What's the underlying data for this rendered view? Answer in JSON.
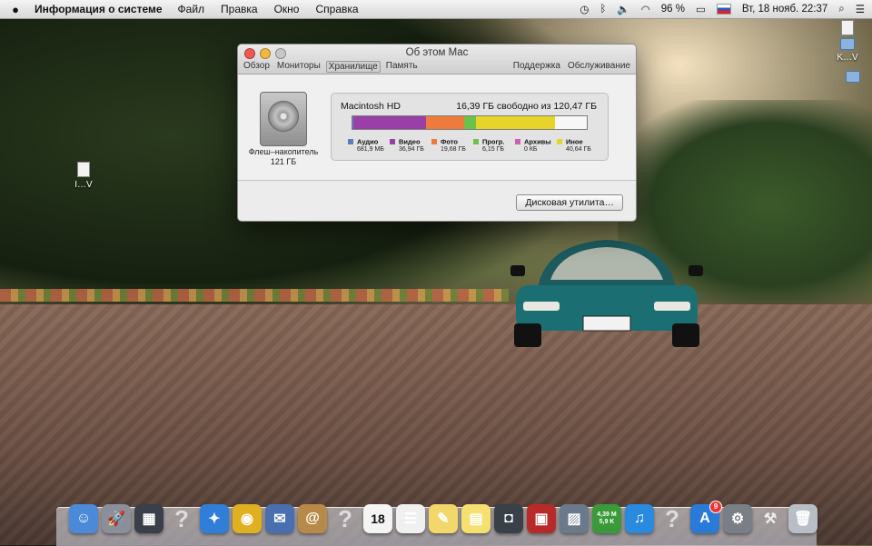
{
  "menubar": {
    "app_name": "Информация о системе",
    "menus": [
      "Файл",
      "Правка",
      "Окно",
      "Справка"
    ],
    "battery": "96 %",
    "clock": "Вт, 18 нояб.  22:37"
  },
  "desktop": {
    "icon_left_label": "I…V",
    "icon_right_label": "K…V"
  },
  "window": {
    "title": "Об этом Mac",
    "tabs": [
      "Обзор",
      "Мониторы",
      "Хранилище",
      "Память"
    ],
    "active_tab": "Хранилище",
    "right_links": [
      "Поддержка",
      "Обслуживание"
    ],
    "disk": {
      "type_label": "Флеш–накопитель",
      "size_label": "121 ГБ",
      "name": "Macintosh HD",
      "free_text": "16,39 ГБ свободно из 120,47 ГБ",
      "total_gb": 120.47,
      "free_gb": 16.39
    },
    "categories": [
      {
        "name": "Аудио",
        "value": "681,9 МБ",
        "color": "#5a7ec4",
        "gb": 0.68
      },
      {
        "name": "Видео",
        "value": "36,94 ГБ",
        "color": "#9b3fa8",
        "gb": 36.94
      },
      {
        "name": "Фото",
        "value": "19,68 ГБ",
        "color": "#ee7a3c",
        "gb": 19.68
      },
      {
        "name": "Прогр.",
        "value": "6,15 ГБ",
        "color": "#6ac24a",
        "gb": 6.15
      },
      {
        "name": "Архивы",
        "value": "0 КБ",
        "color": "#cc5eb4",
        "gb": 0
      },
      {
        "name": "Иное",
        "value": "40,64 ГБ",
        "color": "#e6d428",
        "gb": 40.64
      }
    ],
    "disk_utility_button": "Дисковая утилита…"
  },
  "dock": {
    "apps": [
      {
        "icon": "finder-icon",
        "color": "#4a8ad8",
        "glyph": "☺"
      },
      {
        "icon": "launchpad-icon",
        "color": "#8a8f9a",
        "glyph": "🚀"
      },
      {
        "icon": "mission-control-icon",
        "color": "#3a3f4a",
        "glyph": "▦"
      },
      {
        "icon": "unknown-app-icon",
        "color": "",
        "glyph": "?"
      },
      {
        "icon": "safari-icon",
        "color": "#2f7fd8",
        "glyph": "✦"
      },
      {
        "icon": "chrome-icon",
        "color": "#e0b020",
        "glyph": "◉"
      },
      {
        "icon": "mail-icon",
        "color": "#4a6fb0",
        "glyph": "✉"
      },
      {
        "icon": "contacts-icon",
        "color": "#b88a4a",
        "glyph": "@"
      },
      {
        "icon": "unknown-app-icon",
        "color": "",
        "glyph": "?"
      },
      {
        "icon": "calendar-icon",
        "color": "#f4f4f4",
        "glyph": "18"
      },
      {
        "icon": "reminders-icon",
        "color": "#f0f0f0",
        "glyph": "☰"
      },
      {
        "icon": "notes-icon",
        "color": "#f2d86a",
        "glyph": "✎"
      },
      {
        "icon": "stickies-icon",
        "color": "#f6e070",
        "glyph": "▤"
      },
      {
        "icon": "facetime-icon",
        "color": "#3a4048",
        "glyph": "◘"
      },
      {
        "icon": "photo-booth-icon",
        "color": "#b82a2a",
        "glyph": "▣"
      },
      {
        "icon": "iphoto-icon",
        "color": "#6a7a8a",
        "glyph": "▨"
      },
      {
        "icon": "network-monitor-icon",
        "color": "#3a9a3a",
        "glyph": "4,39 M / 5,9 K"
      },
      {
        "icon": "itunes-icon",
        "color": "#2a8ae0",
        "glyph": "♫"
      },
      {
        "icon": "unknown-app-icon",
        "color": "",
        "glyph": "?"
      },
      {
        "icon": "app-store-icon",
        "color": "#2a7ad8",
        "glyph": "A",
        "badge": "9"
      },
      {
        "icon": "system-preferences-icon",
        "color": "#7a7e86",
        "glyph": "⚙"
      },
      {
        "icon": "utilities-icon",
        "color": "",
        "glyph": "⚒"
      },
      {
        "icon": "trash-icon",
        "color": "#b9bec6",
        "glyph": "🗑"
      }
    ]
  }
}
